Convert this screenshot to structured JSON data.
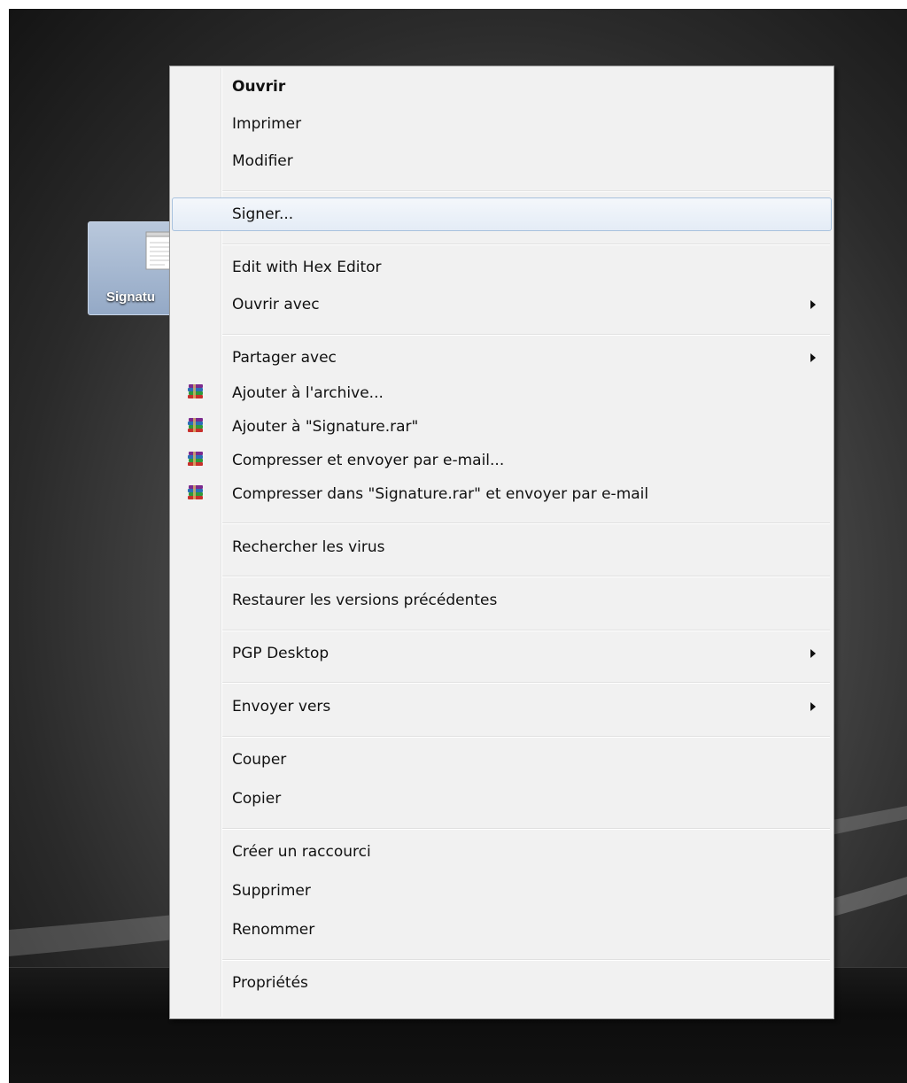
{
  "desktop": {
    "icon_label": "Signatu"
  },
  "menu": {
    "items": [
      {
        "label": "Ouvrir"
      },
      {
        "label": "Imprimer"
      },
      {
        "label": "Modifier"
      },
      {
        "label": "Signer..."
      },
      {
        "label": "Edit with Hex Editor"
      },
      {
        "label": "Ouvrir avec"
      },
      {
        "label": "Partager avec"
      },
      {
        "label": "Ajouter à l'archive..."
      },
      {
        "label": "Ajouter à \"Signature.rar\""
      },
      {
        "label": "Compresser et envoyer par e-mail..."
      },
      {
        "label": "Compresser dans \"Signature.rar\" et envoyer par e-mail"
      },
      {
        "label": "Rechercher les virus"
      },
      {
        "label": "Restaurer les versions précédentes"
      },
      {
        "label": "PGP Desktop"
      },
      {
        "label": "Envoyer vers"
      },
      {
        "label": "Couper"
      },
      {
        "label": "Copier"
      },
      {
        "label": "Créer un raccourci"
      },
      {
        "label": "Supprimer"
      },
      {
        "label": "Renommer"
      },
      {
        "label": "Propriétés"
      }
    ],
    "highlighted_item": "Signer...",
    "default_item": "Ouvrir",
    "submenu_items": [
      "Ouvrir avec",
      "Partager avec",
      "PGP Desktop",
      "Envoyer vers"
    ],
    "winrar_icon_items": [
      "Ajouter à l'archive...",
      "Ajouter à \"Signature.rar\"",
      "Compresser et envoyer par e-mail...",
      "Compresser dans \"Signature.rar\" et envoyer par e-mail"
    ],
    "submenu_arrow_icon": "chevron-right-icon",
    "winrar_icon": "winrar-books-icon"
  },
  "colors": {
    "menu_background": "#f1f1f1",
    "highlight_border": "#a8c2de",
    "highlight_fill": "#e4ecf6",
    "text": "#111111",
    "selected_icon": "#94a9c6"
  }
}
